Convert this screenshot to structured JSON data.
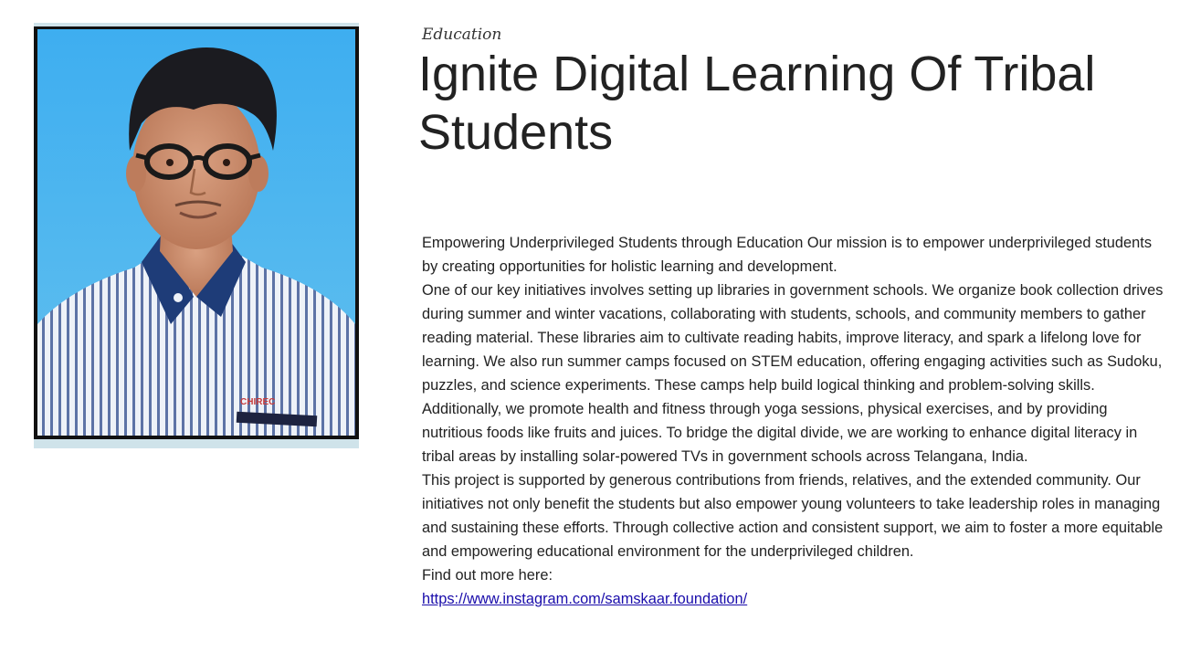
{
  "post": {
    "category": "Education",
    "title": "Ignite Digital Learning Of Tribal Students",
    "paragraphs": [
      "Empowering Underprivileged Students through Education Our mission is to empower underprivileged students by creating opportunities for holistic learning and development.",
      "One of our key initiatives involves setting up libraries in government schools. We organize book collection drives during summer and winter vacations, collaborating with students, schools, and community members to gather reading material. These libraries aim to cultivate reading habits, improve literacy, and spark a lifelong love for learning. We also run summer camps focused on STEM education, offering engaging activities such as Sudoku, puzzles, and science experiments. These camps help build logical thinking and problem-solving skills.",
      "Additionally, we promote health and fitness through yoga sessions, physical exercises, and by providing nutritious foods like fruits and juices. To bridge the digital divide, we are working to enhance digital literacy in tribal areas by installing solar-powered TVs in government schools across Telangana, India.",
      "This project is supported by generous contributions from friends, relatives, and the extended community. Our initiatives not only benefit the students but also empower young volunteers to take leadership roles in managing and sustaining these efforts. Through collective action and consistent support, we aim to foster a more equitable and empowering educational environment for the underprivileged children.",
      "Find out more here:"
    ],
    "link": {
      "text": "https://www.instagram.com/samskaar.foundation/",
      "href": "https://www.instagram.com/samskaar.foundation/"
    }
  },
  "photo": {
    "badge_text": "CHIREC",
    "colors": {
      "background": "#4fb3ea",
      "shirt": "#e8eef6",
      "stripe": "#5a6fa0",
      "collar": "#1f3f7a",
      "hair": "#1c1c22",
      "skin": "#c98a6a"
    }
  }
}
